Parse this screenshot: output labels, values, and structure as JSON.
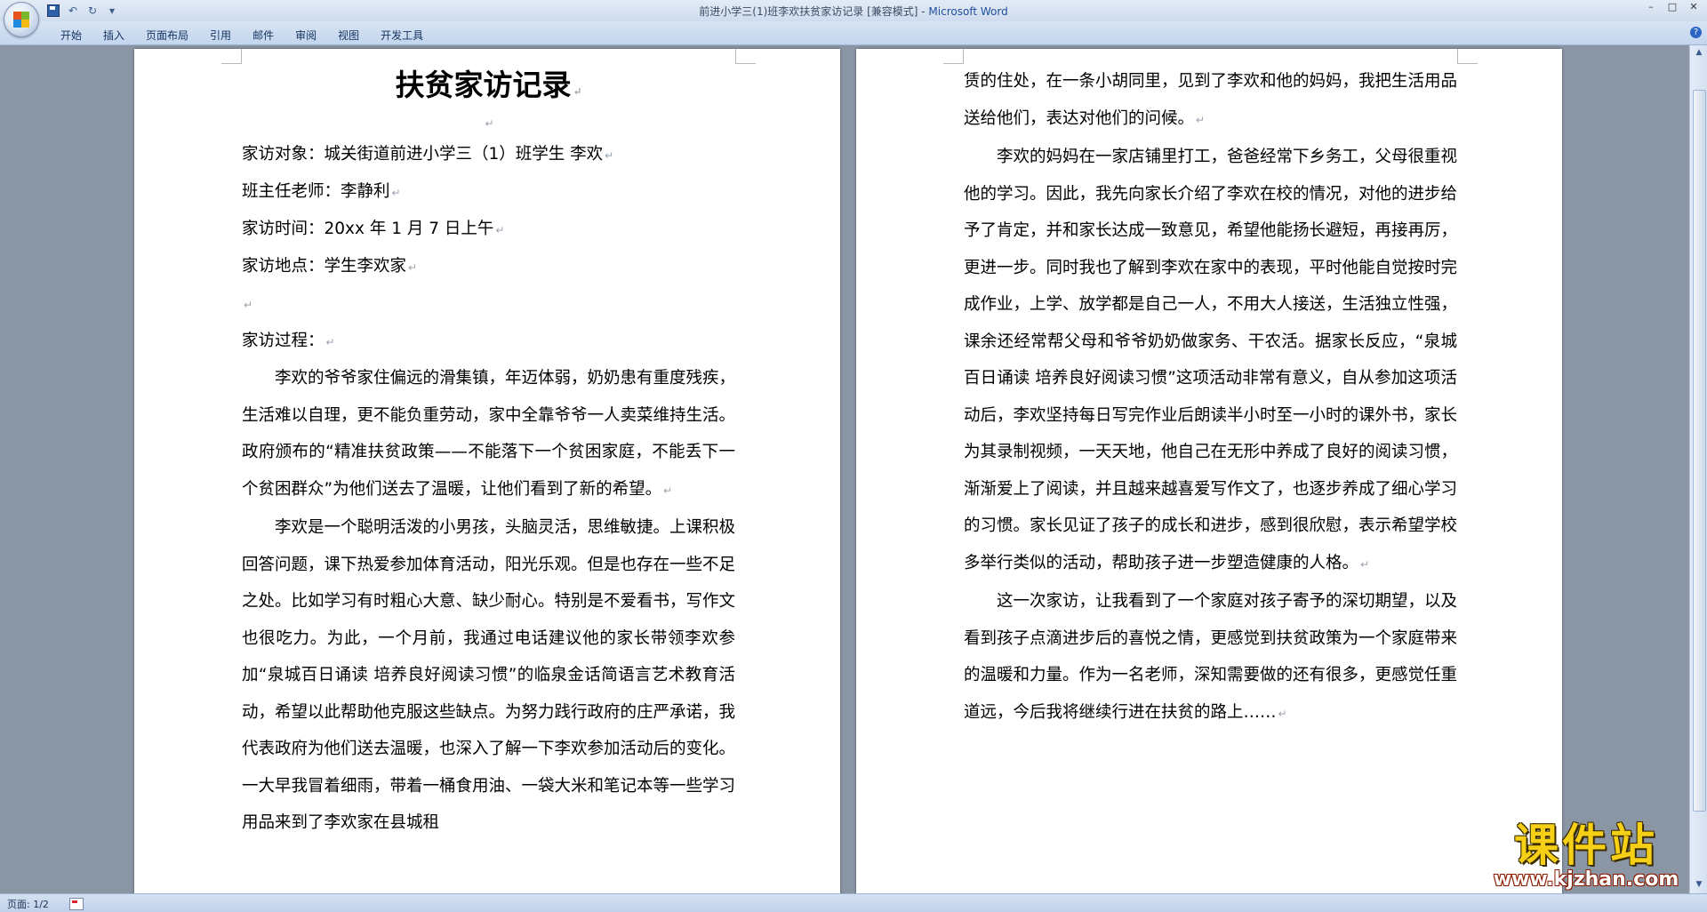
{
  "window": {
    "title_doc": "前进小学三(1)班李欢扶贫家访记录 [兼容模式] - ",
    "title_app": "Microsoft Word",
    "controls": [
      "–",
      "□",
      "✕"
    ]
  },
  "qat": {
    "icons": [
      "save-icon",
      "undo-icon",
      "redo-icon",
      "customize-icon"
    ],
    "undo_glyph": "↶",
    "redo_glyph": "↻",
    "more_glyph": "▾"
  },
  "ribbon": {
    "tabs": [
      "开始",
      "插入",
      "页面布局",
      "引用",
      "邮件",
      "审阅",
      "视图",
      "开发工具"
    ],
    "help_glyph": "?"
  },
  "document": {
    "title": "扶贫家访记录",
    "pmark": "↵",
    "left_info": [
      "家访对象：城关街道前进小学三（1）班学生 李欢",
      "班主任老师：李静利",
      "家访时间：20xx 年 1 月 7 日上午",
      "家访地点：学生李欢家"
    ],
    "process_label": "家访过程：",
    "left_para1": "李欢的爷爷家住偏远的滑集镇，年迈体弱，奶奶患有重度残疾，生活难以自理，更不能负重劳动，家中全靠爷爷一人卖菜维持生活。政府颁布的“精准扶贫政策——不能落下一个贫困家庭，不能丢下一个贫困群众”为他们送去了温暖，让他们看到了新的希望。",
    "left_para2": "李欢是一个聪明活泼的小男孩，头脑灵活，思维敏捷。上课积极回答问题，课下热爱参加体育活动，阳光乐观。但是也存在一些不足之处。比如学习有时粗心大意、缺少耐心。特别是不爱看书，写作文也很吃力。为此，一个月前，我通过电话建议他的家长带领李欢参加“泉城百日诵读 培养良好阅读习惯”的临泉金话简语言艺术教育活动，希望以此帮助他克服这些缺点。为努力践行政府的庄严承诺，我代表政府为他们送去温暖，也深入了解一下李欢参加活动后的变化。一大早我冒着细雨，带着一桶食用油、一袋大米和笔记本等一些学习用品来到了李欢家在县城租",
    "right_para0": "赁的住处，在一条小胡同里，见到了李欢和他的妈妈，我把生活用品送给他们，表达对他们的问候。",
    "right_para1": "李欢的妈妈在一家店铺里打工，爸爸经常下乡务工，父母很重视他的学习。因此，我先向家长介绍了李欢在校的情况，对他的进步给予了肯定，并和家长达成一致意见，希望他能扬长避短，再接再厉，更进一步。同时我也了解到李欢在家中的表现，平时他能自觉按时完成作业，上学、放学都是自己一人，不用大人接送，生活独立性强，课余还经常帮父母和爷爷奶奶做家务、干农活。据家长反应，“泉城百日诵读 培养良好阅读习惯”这项活动非常有意义，自从参加这项活动后，李欢坚持每日写完作业后朗读半小时至一小时的课外书，家长为其录制视频，一天天地，他自己在无形中养成了良好的阅读习惯，渐渐爱上了阅读，并且越来越喜爱写作文了，也逐步养成了细心学习的习惯。家长见证了孩子的成长和进步，感到很欣慰，表示希望学校多举行类似的活动，帮助孩子进一步塑造健康的人格。",
    "right_para2": "这一次家访，让我看到了一个家庭对孩子寄予的深切期望，以及看到孩子点滴进步后的喜悦之情，更感觉到扶贫政策为一个家庭带来的温暖和力量。作为一名老师，深知需要做的还有很多，更感觉任重道远，今后我将继续行进在扶贫的路上……"
  },
  "scrollbar": {
    "up": "▲",
    "down": "▼"
  },
  "status": {
    "page": "页面: 1/2"
  },
  "watermark": {
    "title": "课件站",
    "url": "www.kjzhan.com"
  }
}
